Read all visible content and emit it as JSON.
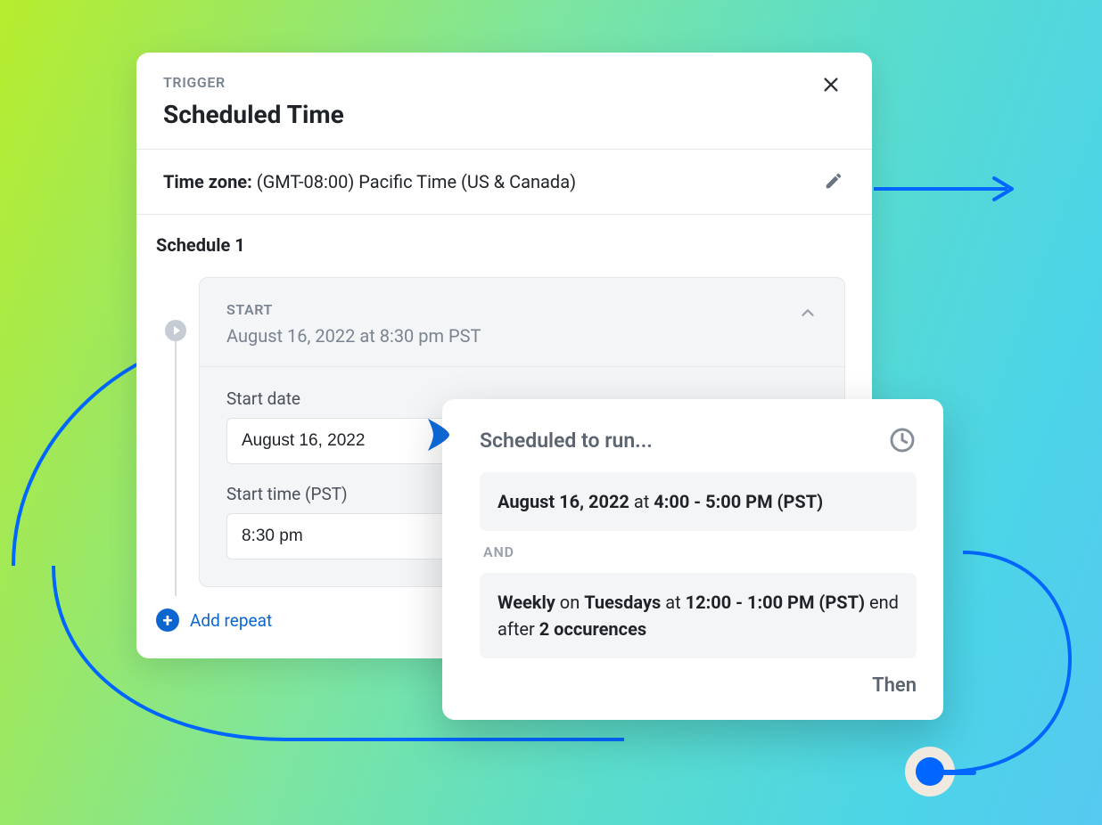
{
  "panel": {
    "eyebrow": "TRIGGER",
    "title": "Scheduled Time",
    "timezone": {
      "label": "Time zone:",
      "value": "(GMT-08:00) Pacific Time (US & Canada)"
    },
    "schedule": {
      "heading": "Schedule 1",
      "start": {
        "label": "START",
        "summary": "August 16, 2022 at 8:30 pm PST",
        "fields": {
          "date_label": "Start date",
          "date_value": "August 16, 2022",
          "time_label": "Start time (PST)",
          "time_value": "8:30 pm"
        }
      },
      "add_repeat": "Add repeat"
    }
  },
  "popover": {
    "title": "Scheduled to run...",
    "run1": {
      "date": "August 16, 2022",
      "at": " at ",
      "time": "4:00 - 5:00 PM (PST)"
    },
    "and": "AND",
    "run2": {
      "freq": "Weekly",
      "on_word": " on ",
      "day": "Tuesdays",
      "at_word": " at ",
      "time": "12:00 - 1:00 PM (PST)",
      "end_word": " end after ",
      "occur": "2 occurences"
    },
    "then": "Then"
  }
}
